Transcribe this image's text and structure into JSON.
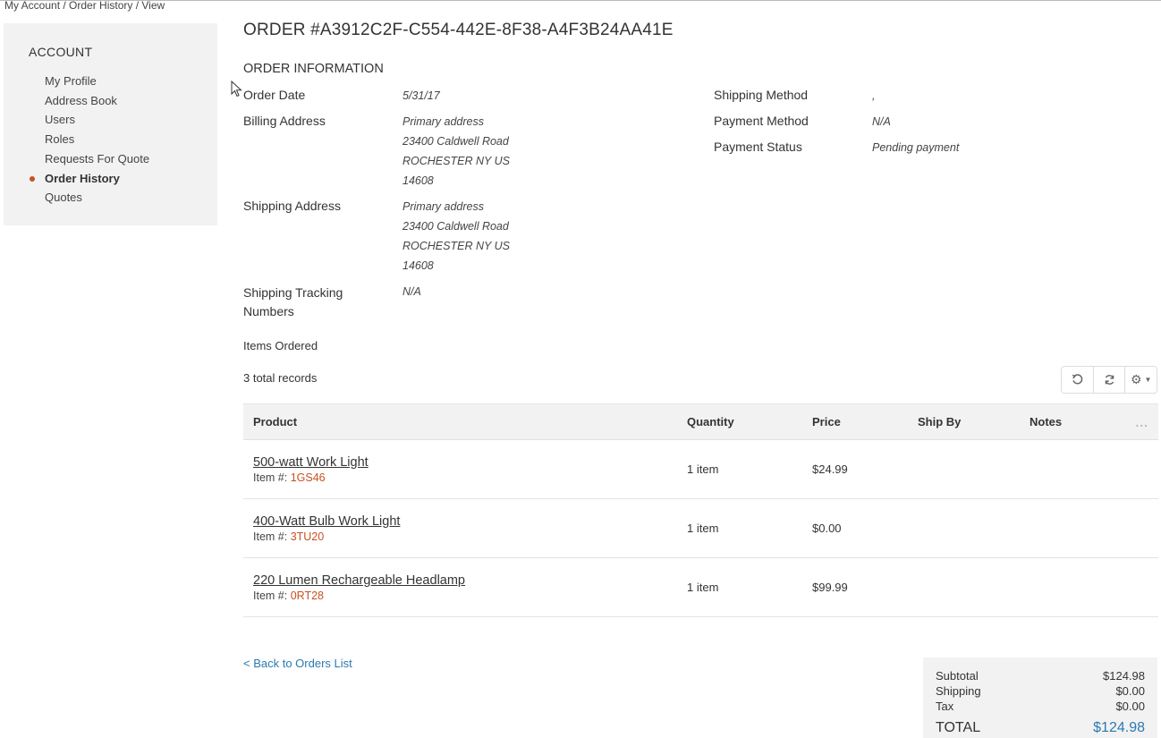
{
  "breadcrumb": {
    "text": "My Account / Order History / View"
  },
  "sidebar": {
    "heading": "ACCOUNT",
    "items": [
      {
        "label": "My Profile"
      },
      {
        "label": "Address Book"
      },
      {
        "label": "Users"
      },
      {
        "label": "Roles"
      },
      {
        "label": "Requests For Quote"
      },
      {
        "label": "Order History",
        "active": true
      },
      {
        "label": "Quotes"
      }
    ]
  },
  "order": {
    "title": "ORDER #A3912C2F-C554-442E-8F38-A4F3B24AA41E",
    "section_title": "ORDER INFORMATION",
    "order_date_label": "Order Date",
    "order_date": "5/31/17",
    "billing_label": "Billing Address",
    "billing": {
      "line1": "Primary address",
      "line2": "23400 Caldwell Road",
      "line3": "ROCHESTER NY US",
      "line4": "14608"
    },
    "shipping_label": "Shipping Address",
    "shipping": {
      "line1": "Primary address",
      "line2": "23400 Caldwell Road",
      "line3": "ROCHESTER NY US",
      "line4": "14608"
    },
    "tracking_label_1": "Shipping Tracking",
    "tracking_label_2": "Numbers",
    "tracking_value": "N/A",
    "shipping_method_label": "Shipping Method",
    "shipping_method": ",",
    "payment_method_label": "Payment Method",
    "payment_method": "N/A",
    "payment_status_label": "Payment Status",
    "payment_status": "Pending payment"
  },
  "items": {
    "label": "Items Ordered",
    "records": "3 total records",
    "columns": {
      "product": "Product",
      "quantity": "Quantity",
      "price": "Price",
      "ship_by": "Ship By",
      "notes": "Notes"
    },
    "more_icon": "...",
    "sku_prefix": "Item #: ",
    "rows": [
      {
        "name": "500-watt Work Light",
        "sku": "1GS46",
        "quantity": "1 item",
        "price": "$24.99"
      },
      {
        "name": "400-Watt Bulb Work Light",
        "sku": "3TU20",
        "quantity": "1 item",
        "price": "$0.00"
      },
      {
        "name": "220 Lumen Rechargeable Headlamp",
        "sku": "0RT28",
        "quantity": "1 item",
        "price": "$99.99"
      }
    ]
  },
  "toolbar": {
    "icons": [
      "reset-icon",
      "refresh-icon",
      "gear-icon"
    ]
  },
  "footer": {
    "back_link": "< Back to Orders List"
  },
  "totals": {
    "subtotal_label": "Subtotal",
    "subtotal": "$124.98",
    "shipping_label": "Shipping",
    "shipping": "$0.00",
    "tax_label": "Tax",
    "tax": "$0.00",
    "total_label": "TOTAL",
    "total": "$124.98"
  },
  "colors": {
    "accent": "#c8511f",
    "link": "#2a7ab0",
    "panel": "#f2f2f2"
  }
}
